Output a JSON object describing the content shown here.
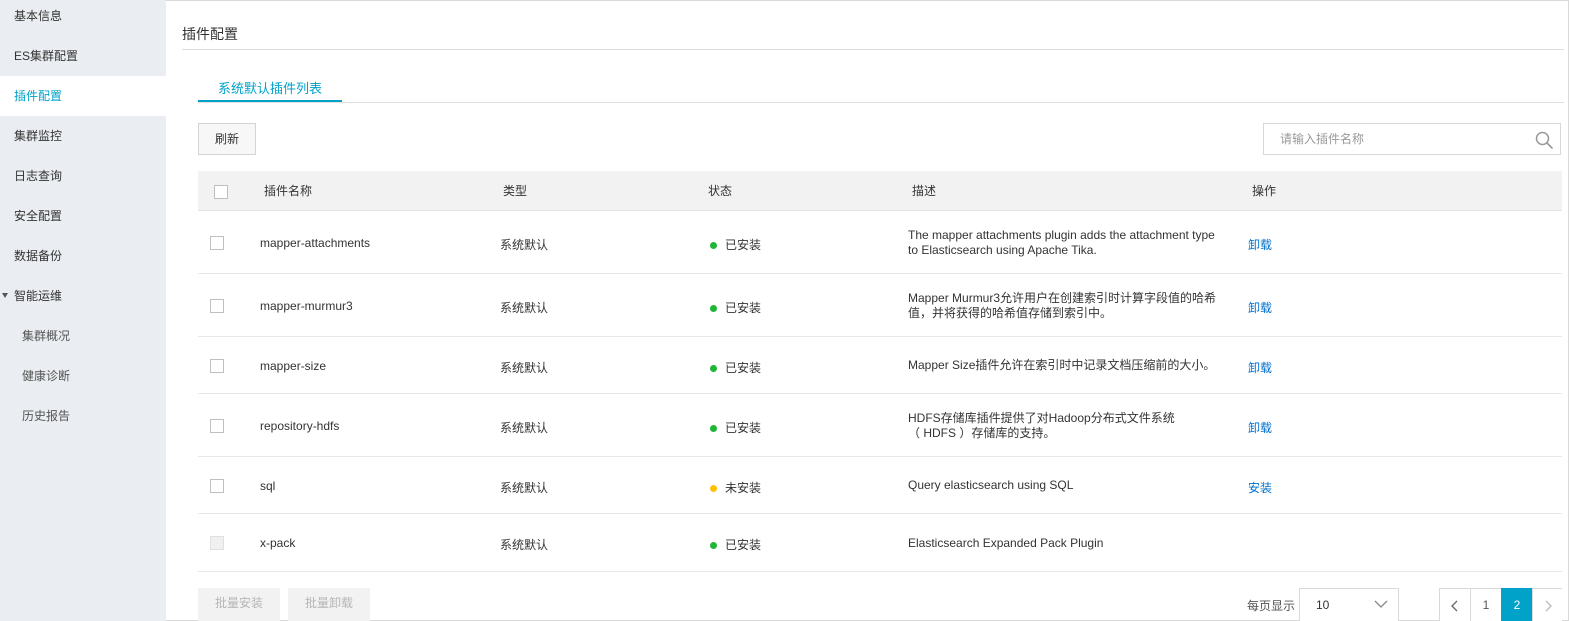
{
  "colors": {
    "accent": "#00a2ca",
    "link": "#0070cc",
    "installed": "#1fb535",
    "not_installed": "#ffc107"
  },
  "sidebar": {
    "items": [
      {
        "label": "基本信息"
      },
      {
        "label": "ES集群配置"
      },
      {
        "label": "插件配置",
        "active": true
      },
      {
        "label": "集群监控"
      },
      {
        "label": "日志查询"
      },
      {
        "label": "安全配置"
      },
      {
        "label": "数据备份"
      },
      {
        "label": "智能运维",
        "expanded": true
      },
      {
        "label": "集群概况",
        "child": true
      },
      {
        "label": "健康诊断",
        "child": true
      },
      {
        "label": "历史报告",
        "child": true
      }
    ]
  },
  "page": {
    "title": "插件配置"
  },
  "tabs": [
    {
      "label": "系统默认插件列表",
      "active": true
    }
  ],
  "toolbar": {
    "refresh_label": "刷新"
  },
  "search": {
    "placeholder": "请输入插件名称",
    "value": ""
  },
  "table": {
    "columns": {
      "name": "插件名称",
      "type": "类型",
      "status": "状态",
      "desc": "描述",
      "action": "操作"
    },
    "rows": [
      {
        "name": "mapper-attachments",
        "type": "系统默认",
        "status": "已安装",
        "status_key": "installed",
        "desc_lines": [
          "The mapper attachments plugin adds the attachment type",
          "to Elasticsearch using Apache Tika."
        ],
        "action": "卸载"
      },
      {
        "name": "mapper-murmur3",
        "type": "系统默认",
        "status": "已安装",
        "status_key": "installed",
        "desc_lines": [
          "Mapper Murmur3允许用户在创建索引时计算字段值的哈希",
          "值，并将获得的哈希值存储到索引中。"
        ],
        "action": "卸载"
      },
      {
        "name": "mapper-size",
        "type": "系统默认",
        "status": "已安装",
        "status_key": "installed",
        "desc_lines": [
          "Mapper Size插件允许在索引时中记录文档压缩前的大小。"
        ],
        "action": "卸载"
      },
      {
        "name": "repository-hdfs",
        "type": "系统默认",
        "status": "已安装",
        "status_key": "installed",
        "desc_lines": [
          "HDFS存储库插件提供了对Hadoop分布式文件系统",
          "（ HDFS ）存储库的支持。"
        ],
        "action": "卸载"
      },
      {
        "name": "sql",
        "type": "系统默认",
        "status": "未安装",
        "status_key": "not_installed",
        "desc_lines": [
          "Query elasticsearch using SQL"
        ],
        "action": "安装"
      },
      {
        "name": "x-pack",
        "type": "系统默认",
        "status": "已安装",
        "status_key": "installed",
        "desc_lines": [
          "Elasticsearch Expanded Pack Plugin"
        ],
        "action": "",
        "disabled": true
      }
    ]
  },
  "footer": {
    "batch_install_label": "批量安装",
    "batch_uninstall_label": "批量卸载",
    "per_page_label": "每页显示",
    "per_page_value": "10",
    "pages": [
      "1",
      "2"
    ],
    "current_page": "2"
  }
}
